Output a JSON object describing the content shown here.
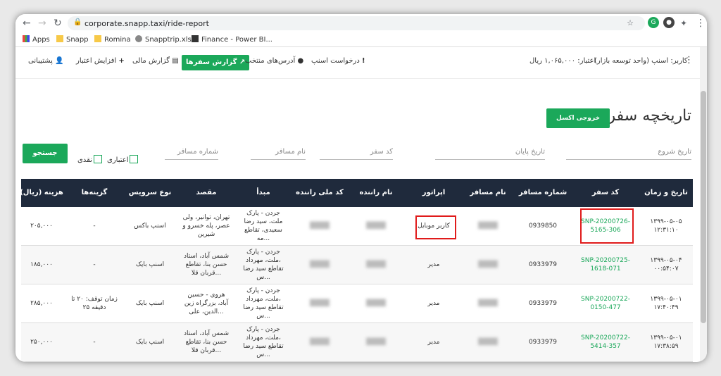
{
  "browser": {
    "url": "corporate.snapp.taxi/ride-report",
    "bookmarks": [
      "Apps",
      "Snapp",
      "Romina",
      "Snapptrip.xlsx",
      "Finance - Power BI..."
    ]
  },
  "nav": {
    "user": "کاربر: اسنپ (واحد توسعه بازار)",
    "credit": "اعتبار: ۱,۰۶۵,۰۰۰ ریال",
    "request": "درخواست اسنپ",
    "addresses": "آدرس‌های منتخب",
    "ride_report": "گزارش سفرها",
    "financial": "گزارش مالی",
    "increase_credit": "افزایش اعتبار",
    "support": "پشتیبانی"
  },
  "page": {
    "title": "تاریخچه سفر",
    "excel_button": "خروجی اکسل"
  },
  "filters": {
    "start_date": "تاریخ شروع",
    "end_date": "تاریخ پایان",
    "ride_code": "کد سفر",
    "passenger_name": "نام مسافر",
    "passenger_number": "شماره مسافر",
    "credit_label": "اعتباری",
    "cash_label": "نقدی",
    "search_button": "جستجو"
  },
  "table": {
    "headers": [
      "تاریخ و زمان",
      "کد سفر",
      "شماره مسافر",
      "نام مسافر",
      "اپراتور",
      "نام راننده",
      "کد ملی راننده",
      "مبدأ",
      "مقصد",
      "نوع سرویس",
      "گزینه‌ها",
      "هزینه (ریال)"
    ],
    "rows": [
      {
        "date": "۱۳۹۹-۰۵-۰۵",
        "time": "۱۲:۳۱:۱۰",
        "code1": "SNP-20200726-",
        "code2": "5165-306",
        "phone": "0939850",
        "pname": "████",
        "operator": "کاربر موبایل",
        "driver": "████",
        "nid": "████",
        "origin": [
          "جردن - پارک",
          "ملت، سید رضا",
          "سعیدی، تقاطع",
          "مه..."
        ],
        "dest": [
          "تهران، توانیر، ولی",
          "عصر، پله خسرو و",
          "شیرین"
        ],
        "service": "اسنپ باکس",
        "options": "-",
        "options2": "",
        "cost": "۲۰۵,۰۰۰"
      },
      {
        "date": "۱۳۹۹-۰۵-۰۴",
        "time": "۰۰:۵۴:۰۷",
        "code1": "SNP-20200725-",
        "code2": "1618-071",
        "phone": "0933979",
        "pname": "████",
        "operator": "مدیر",
        "driver": "████",
        "nid": "████",
        "origin": [
          "جردن - پارک",
          "ملت، مهرداد،",
          "تقاطع سید رضا",
          "س..."
        ],
        "dest": [
          "شمس آباد، استاد",
          "حسن بنا، تقاطع",
          "قربان قلا..."
        ],
        "service": "اسنپ بایک",
        "options": "-",
        "options2": "",
        "cost": "۱۸۵,۰۰۰"
      },
      {
        "date": "۱۳۹۹-۰۵-۰۱",
        "time": "۱۷:۴۰:۴۹",
        "code1": "SNP-20200722-",
        "code2": "0150-477",
        "phone": "0933979",
        "pname": "████",
        "operator": "مدیر",
        "driver": "████",
        "nid": "████",
        "origin": [
          "جردن - پارک",
          "ملت، مهرداد،",
          "تقاطع سید رضا",
          "س..."
        ],
        "dest": [
          "هروی - حسین",
          "آباد، بزرگراه زین",
          "الدین، علی..."
        ],
        "service": "اسنپ بایک",
        "options": "زمان توقف: ۲۰ تا",
        "options2": "۲۵ دقیقه",
        "cost": "۲۸۵,۰۰۰"
      },
      {
        "date": "۱۳۹۹-۰۵-۰۱",
        "time": "۱۷:۳۸:۵۹",
        "code1": "SNP-20200722-",
        "code2": "5414-357",
        "phone": "0933979",
        "pname": "████",
        "operator": "مدیر",
        "driver": "████",
        "nid": "████",
        "origin": [
          "جردن - پارک",
          "ملت، مهرداد،",
          "تقاطع سید رضا",
          "س..."
        ],
        "dest": [
          "شمس آباد، استاد",
          "حسن بنا، تقاطع",
          "قربان قلا..."
        ],
        "service": "اسنپ بایک",
        "options": "-",
        "options2": "",
        "cost": "۲۵۰,۰۰۰"
      }
    ]
  }
}
